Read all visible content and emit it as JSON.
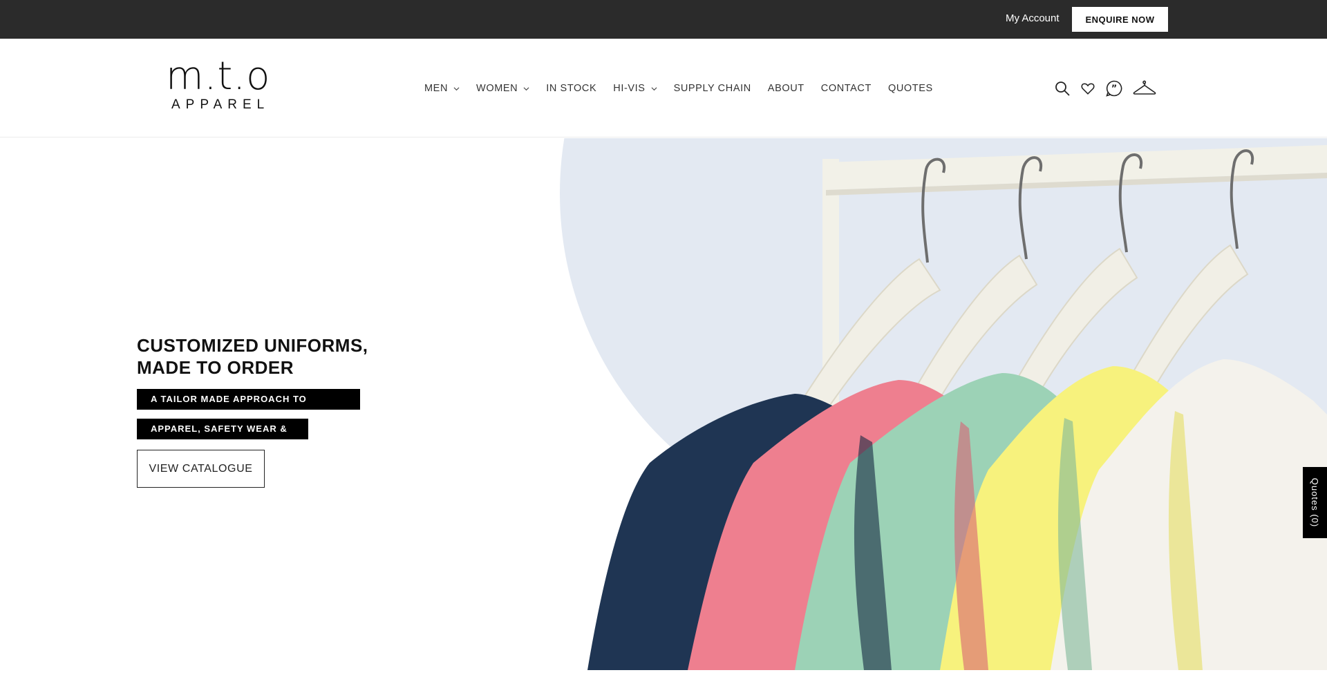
{
  "topbar": {
    "account_label": "My Account",
    "enquire_label": "ENQUIRE NOW"
  },
  "header": {
    "logo_mark": "m.t.o",
    "logo_sub": "APPAREL",
    "nav": [
      {
        "label": "MEN",
        "dropdown": true
      },
      {
        "label": "WOMEN",
        "dropdown": true
      },
      {
        "label": "IN STOCK",
        "dropdown": false
      },
      {
        "label": "HI-VIS",
        "dropdown": true
      },
      {
        "label": "SUPPLY CHAIN",
        "dropdown": false
      },
      {
        "label": "ABOUT",
        "dropdown": false
      },
      {
        "label": "CONTACT",
        "dropdown": false
      },
      {
        "label": "QUOTES",
        "dropdown": false
      }
    ],
    "icons": [
      "search-icon",
      "heart-icon",
      "quote-bubble-icon",
      "hanger-icon"
    ],
    "hanger_count": "0"
  },
  "hero": {
    "title_line1": "CUSTOMIZED UNIFORMS,",
    "title_line2": "MADE TO ORDER",
    "tag1": "A TAILOR MADE APPROACH TO CORPORATE",
    "tag2": "APPAREL, SAFETY WEAR & PPE",
    "cta": "VIEW CATALOGUE",
    "shirt_colors": [
      "#1f3553",
      "#ee7f8f",
      "#9cd2b6",
      "#f7f27d",
      "#f4f2ec"
    ]
  },
  "quotes_tab": {
    "label": "Quotes (0)"
  },
  "colors": {
    "topbar_bg": "#2b2b2b",
    "circle_bg": "#e3e9f2",
    "rail": "#f2f1e8"
  }
}
